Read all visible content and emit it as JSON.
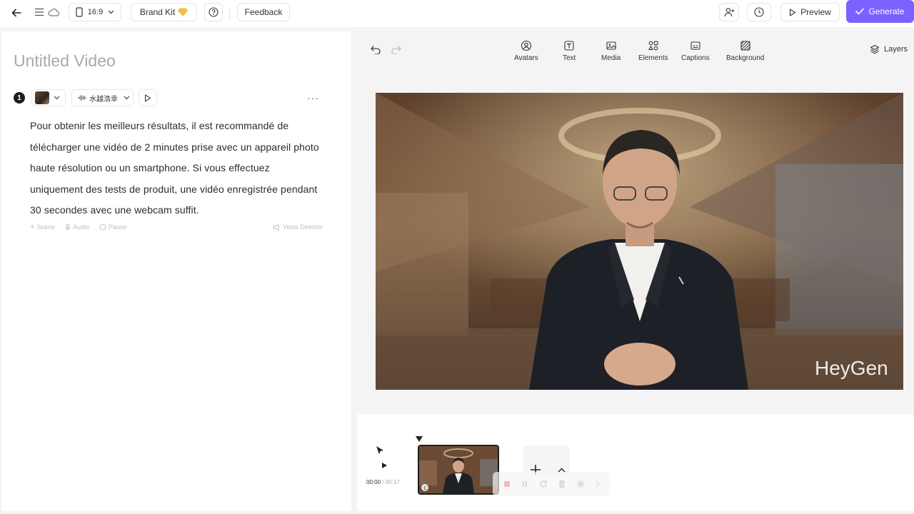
{
  "topbar": {
    "aspect_ratio": "16:9",
    "brand_kit_label": "Brand Kit",
    "feedback_label": "Feedback",
    "preview_label": "Preview",
    "generate_label": "Generate"
  },
  "left": {
    "title": "Untitled Video",
    "scene_number": "1",
    "voice_name": "水越浩幸",
    "more_label": "···",
    "script_text": "Pour obtenir les meilleurs résultats, il est recommandé de télécharger une vidéo de 2 minutes prise avec un appareil photo haute résolution ou un smartphone. Si vous effectuez uniquement des tests de produit, une vidéo enregistrée pendant 30 secondes avec une webcam suffit.",
    "tools": {
      "scene": "Scene",
      "audio": "Audio",
      "pause": "Pause",
      "voice_director": "Voice Director"
    }
  },
  "toolbar": {
    "items": [
      {
        "label": "Avatars",
        "icon": "avatar-icon"
      },
      {
        "label": "Text",
        "icon": "text-icon"
      },
      {
        "label": "Media",
        "icon": "media-icon"
      },
      {
        "label": "Elements",
        "icon": "elements-icon"
      },
      {
        "label": "Captions",
        "icon": "captions-icon"
      },
      {
        "label": "Background",
        "icon": "background-icon"
      }
    ],
    "layers_label": "Layers"
  },
  "video": {
    "watermark": "HeyGen"
  },
  "timeline": {
    "current_time": "00:00",
    "separator": " / ",
    "total_time": "00:17",
    "clip_number": "1"
  },
  "colors": {
    "accent": "#7b61ff",
    "panel_bg": "#ffffff",
    "app_bg": "#f4f4f5"
  }
}
